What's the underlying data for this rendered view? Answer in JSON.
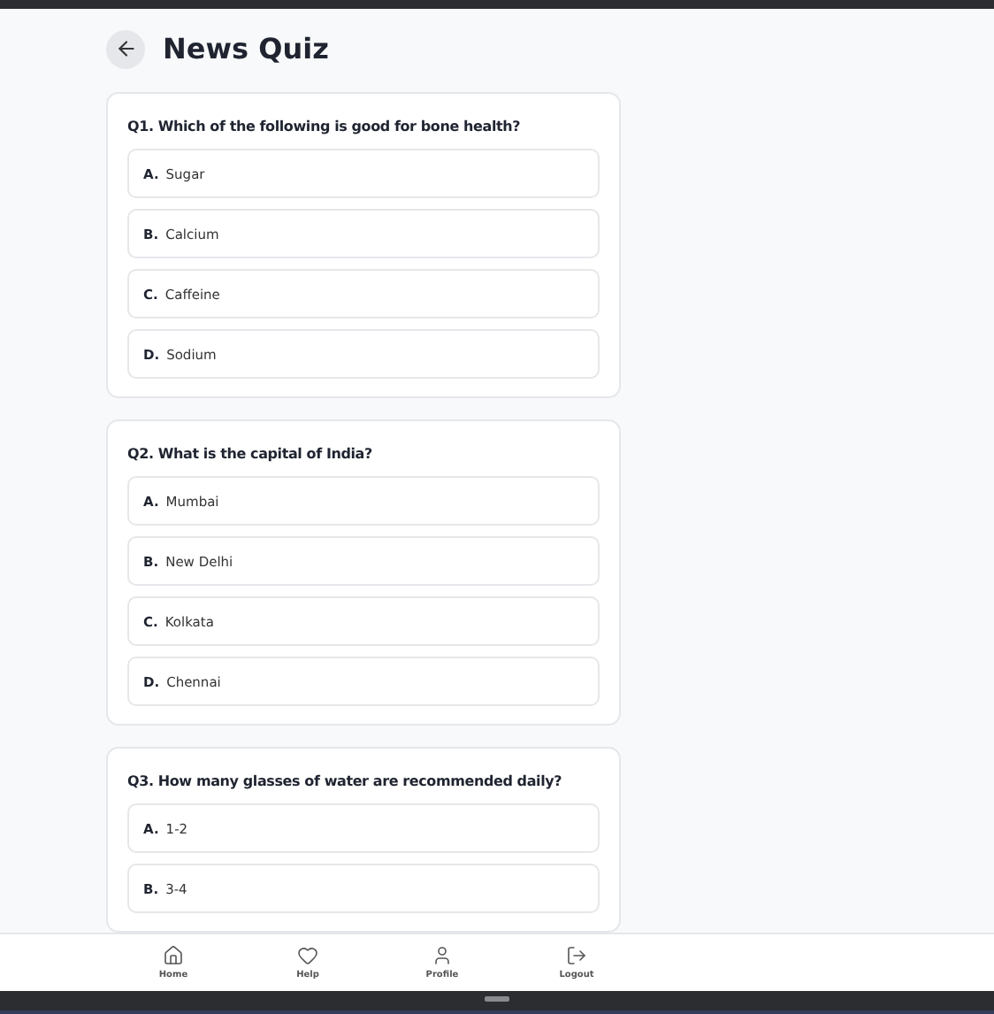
{
  "title": "News Quiz",
  "questions": [
    {
      "text": "Q1. Which of the following is good for bone health?",
      "options": [
        {
          "letter": "A.",
          "text": "Sugar"
        },
        {
          "letter": "B.",
          "text": "Calcium"
        },
        {
          "letter": "C.",
          "text": "Caffeine"
        },
        {
          "letter": "D.",
          "text": "Sodium"
        }
      ]
    },
    {
      "text": "Q2. What is the capital of India?",
      "options": [
        {
          "letter": "A.",
          "text": "Mumbai"
        },
        {
          "letter": "B.",
          "text": "New Delhi"
        },
        {
          "letter": "C.",
          "text": "Kolkata"
        },
        {
          "letter": "D.",
          "text": "Chennai"
        }
      ]
    },
    {
      "text": "Q3. How many glasses of water are recommended daily?",
      "options": [
        {
          "letter": "A.",
          "text": "1-2"
        },
        {
          "letter": "B.",
          "text": "3-4"
        }
      ]
    }
  ],
  "nav": [
    {
      "kind": "home",
      "label": "Home"
    },
    {
      "kind": "help",
      "label": "Help"
    },
    {
      "kind": "profile",
      "label": "Profile"
    },
    {
      "kind": "logout",
      "label": "Logout"
    }
  ]
}
